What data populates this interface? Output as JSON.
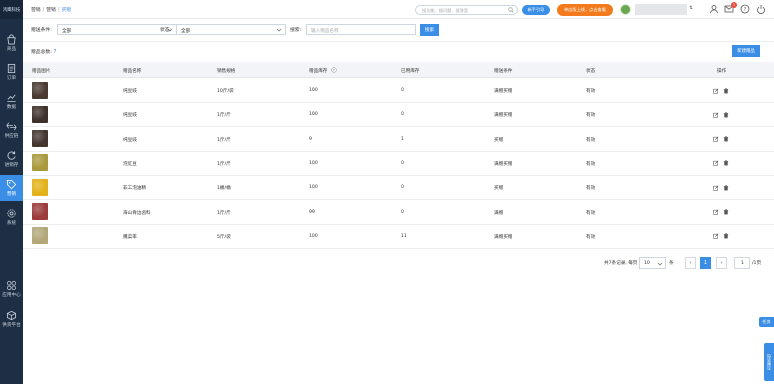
{
  "sidebar": {
    "logo": "鸿鹰科技",
    "items": [
      {
        "label": "商品",
        "icon": "bag-icon"
      },
      {
        "label": "订单",
        "icon": "document-icon"
      },
      {
        "label": "数据",
        "icon": "chart-icon"
      },
      {
        "label": "供应链",
        "icon": "exchange-icon"
      },
      {
        "label": "进销存",
        "icon": "cycle-icon"
      },
      {
        "label": "营销",
        "icon": "tag-icon",
        "active": true
      },
      {
        "label": "系统",
        "icon": "gear-icon"
      },
      {
        "label": "应用中心",
        "icon": "apps-icon"
      },
      {
        "label": "供货平台",
        "icon": "box-icon"
      }
    ]
  },
  "topbar": {
    "breadcrumb": [
      "营销",
      "营销",
      "买赠"
    ],
    "search_placeholder": "搜功能、搜问题、搜答案",
    "guide_label": "新手引导",
    "promo_label": "单店版上线，点击查看"
  },
  "filters": {
    "condition_label": "赠送条件:",
    "condition_value": "全部",
    "status_label": "状态:",
    "status_value": "全部",
    "search_label": "搜索:",
    "search_placeholder": "输入赠品名称",
    "search_button": "搜索"
  },
  "summary": {
    "total_label": "赠品总数:",
    "total_count": "7",
    "new_button": "新建赠品"
  },
  "table": {
    "columns": [
      "赠品图片",
      "赠品名称",
      "销售规格",
      "赠品库存",
      "已用库存",
      "赠送条件",
      "状态",
      "操作"
    ],
    "rows": [
      {
        "name": "纯豆豉",
        "spec": "10斤/袋",
        "stock": "100",
        "used": "0",
        "condition": "满赠买赠",
        "status": "有效",
        "img": "#4a3a33"
      },
      {
        "name": "纯豆豉",
        "spec": "1斤/斤",
        "stock": "100",
        "used": "0",
        "condition": "满赠买赠",
        "status": "有效",
        "img": "#3e312c"
      },
      {
        "name": "纯豆豉",
        "spec": "1斤/斤",
        "stock": "9",
        "used": "1",
        "condition": "买赠",
        "status": "有效",
        "img": "#43362f"
      },
      {
        "name": "泡豇豆",
        "spec": "1斤/斤",
        "stock": "100",
        "used": "0",
        "condition": "满赠买赠",
        "status": "有效",
        "img": "#a99a3e"
      },
      {
        "name": "非工泡油精",
        "spec": "1桶/桶",
        "stock": "100",
        "used": "0",
        "condition": "买赠",
        "status": "有效",
        "img": "#e3b21a"
      },
      {
        "name": "海山骨边卤料",
        "spec": "1斤/斤",
        "stock": "99",
        "used": "0",
        "condition": "满赠",
        "status": "有效",
        "img": "#9b3b3b"
      },
      {
        "name": "腌菜率",
        "spec": "5斤/袋",
        "stock": "100",
        "used": "11",
        "condition": "满赠买赠",
        "status": "有效",
        "img": "#b3a77a"
      }
    ]
  },
  "pagination": {
    "summary": "共7条记录, 每页",
    "page_size": "10",
    "unit": "条",
    "prev": "‹",
    "current": "1",
    "next": "›",
    "goto_value": "1",
    "total_pages": "/1页"
  },
  "floating": {
    "tag": "任务",
    "side": "投诉建议"
  },
  "colors": {
    "accent": "#3a8ee6",
    "sidebar_bg": "#1e2f45",
    "promo": "#f37b1d"
  }
}
